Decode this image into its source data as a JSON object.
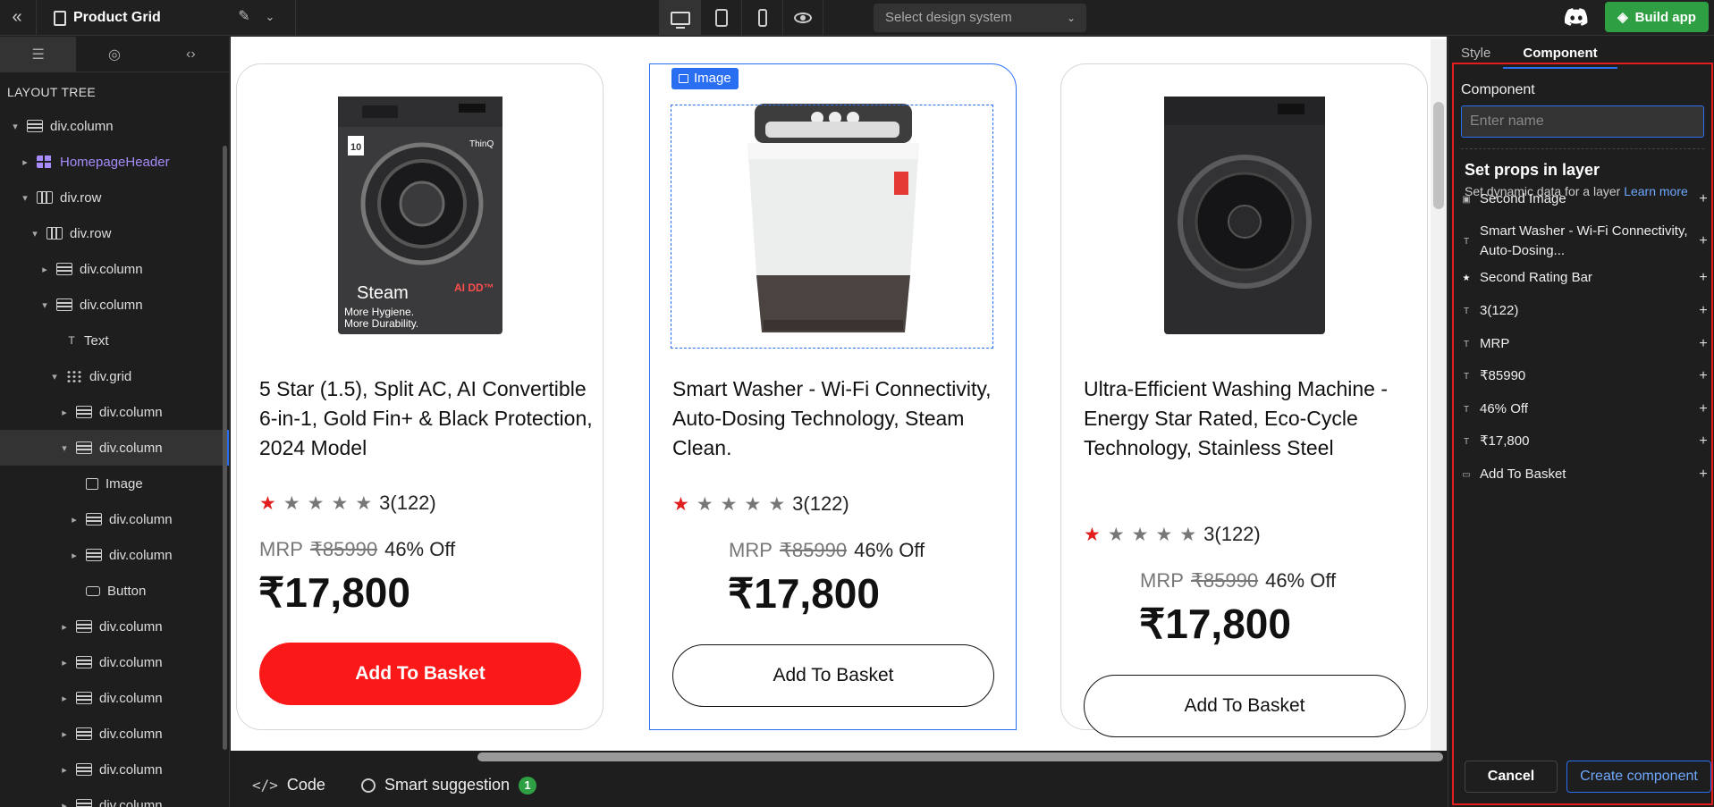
{
  "topbar": {
    "title": "Product Grid",
    "design_system_placeholder": "Select design system",
    "build_label": "Build app"
  },
  "left_panel": {
    "heading": "LAYOUT TREE",
    "tree": [
      {
        "label": "div.column",
        "icon": "column-icon",
        "arrow": "▾",
        "indent": 0
      },
      {
        "label": "HomepageHeader",
        "icon": "component-icon",
        "arrow": "▸",
        "indent": 1,
        "accent": "#a78bfa"
      },
      {
        "label": "div.row",
        "icon": "row-icon",
        "arrow": "▾",
        "indent": 1
      },
      {
        "label": "div.row",
        "icon": "row-icon",
        "arrow": "▾",
        "indent": 2
      },
      {
        "label": "div.column",
        "icon": "column-icon",
        "arrow": "▸",
        "indent": 3
      },
      {
        "label": "div.column",
        "icon": "column-icon",
        "arrow": "▾",
        "indent": 3
      },
      {
        "label": "Text",
        "icon": "text-icon",
        "arrow": "",
        "indent": 4
      },
      {
        "label": "div.grid",
        "icon": "grid-icon",
        "arrow": "▾",
        "indent": 4
      },
      {
        "label": "div.column",
        "icon": "column-icon",
        "arrow": "▸",
        "indent": 5
      },
      {
        "label": "div.column",
        "icon": "column-icon",
        "arrow": "▾",
        "indent": 5,
        "selected": true
      },
      {
        "label": "Image",
        "icon": "image-icon",
        "arrow": "",
        "indent": 6
      },
      {
        "label": "div.column",
        "icon": "column-icon",
        "arrow": "▸",
        "indent": 6
      },
      {
        "label": "div.column",
        "icon": "column-icon",
        "arrow": "▸",
        "indent": 6
      },
      {
        "label": "Button",
        "icon": "button-icon",
        "arrow": "",
        "indent": 6
      },
      {
        "label": "div.column",
        "icon": "column-icon",
        "arrow": "▸",
        "indent": 5
      },
      {
        "label": "div.column",
        "icon": "column-icon",
        "arrow": "▸",
        "indent": 5
      },
      {
        "label": "div.column",
        "icon": "column-icon",
        "arrow": "▸",
        "indent": 5
      },
      {
        "label": "div.column",
        "icon": "column-icon",
        "arrow": "▸",
        "indent": 5
      },
      {
        "label": "div.column",
        "icon": "column-icon",
        "arrow": "▸",
        "indent": 5
      },
      {
        "label": "div.column",
        "icon": "column-icon",
        "arrow": "▸",
        "indent": 5
      }
    ]
  },
  "products": [
    {
      "title": "5 Star (1.5), Split AC, AI Convertible 6-in-1, Gold Fin+ & Black Protection, 2024 Model",
      "rating_count": "3(122)",
      "filled_stars": 1,
      "mrp_label": "MRP",
      "mrp": "₹85990",
      "discount": "46% Off",
      "price": "₹17,800",
      "button": "Add To Basket",
      "image_text": [
        "ThinQ",
        "10",
        "Steam",
        "More Hygiene.",
        "More Durability.",
        "AI DD™"
      ]
    },
    {
      "title": "Smart Washer - Wi-Fi Connectivity, Auto-Dosing Technology, Steam Clean.",
      "rating_count": "3(122)",
      "filled_stars": 1,
      "mrp_label": "MRP",
      "mrp": "₹85990",
      "discount": "46% Off",
      "price": "₹17,800",
      "button": "Add To Basket"
    },
    {
      "title": "Ultra-Efficient Washing Machine - Energy Star Rated, Eco-Cycle Technology, Stainless Steel",
      "rating_count": "3(122)",
      "filled_stars": 1,
      "mrp_label": "MRP",
      "mrp": "₹85990",
      "discount": "46% Off",
      "price": "₹17,800",
      "button": "Add To Basket"
    }
  ],
  "selection_tag": "Image",
  "bottombar": {
    "code_label": "Code",
    "suggestion_label": "Smart suggestion",
    "suggestion_count": "1"
  },
  "right_panel": {
    "tabs": [
      "Style",
      "Component"
    ],
    "component_label": "Component",
    "name_placeholder": "Enter name",
    "set_props_title": "Set props in layer",
    "set_props_sub": "Set dynamic data for a layer",
    "learn_more": "Learn more",
    "props": [
      {
        "label": "Second Image",
        "icon": "image-icon"
      },
      {
        "label": "Smart Washer - Wi-Fi Connectivity, Auto-Dosing...",
        "icon": "text-icon"
      },
      {
        "label": "Second Rating Bar",
        "icon": "star-icon"
      },
      {
        "label": "3(122)",
        "icon": "text-icon"
      },
      {
        "label": "MRP",
        "icon": "text-icon"
      },
      {
        "label": "₹85990",
        "icon": "text-icon"
      },
      {
        "label": "46% Off",
        "icon": "text-icon"
      },
      {
        "label": "₹17,800",
        "icon": "text-icon"
      },
      {
        "label": "Add To Basket",
        "icon": "button-icon"
      }
    ],
    "cancel_label": "Cancel",
    "create_label": "Create component"
  },
  "colors": {
    "accent_blue": "#2a6ff2",
    "build_green": "#2ea043",
    "basket_red": "#fb1818",
    "highlight_red": "#e11d1d",
    "component_purple": "#a78bfa"
  }
}
